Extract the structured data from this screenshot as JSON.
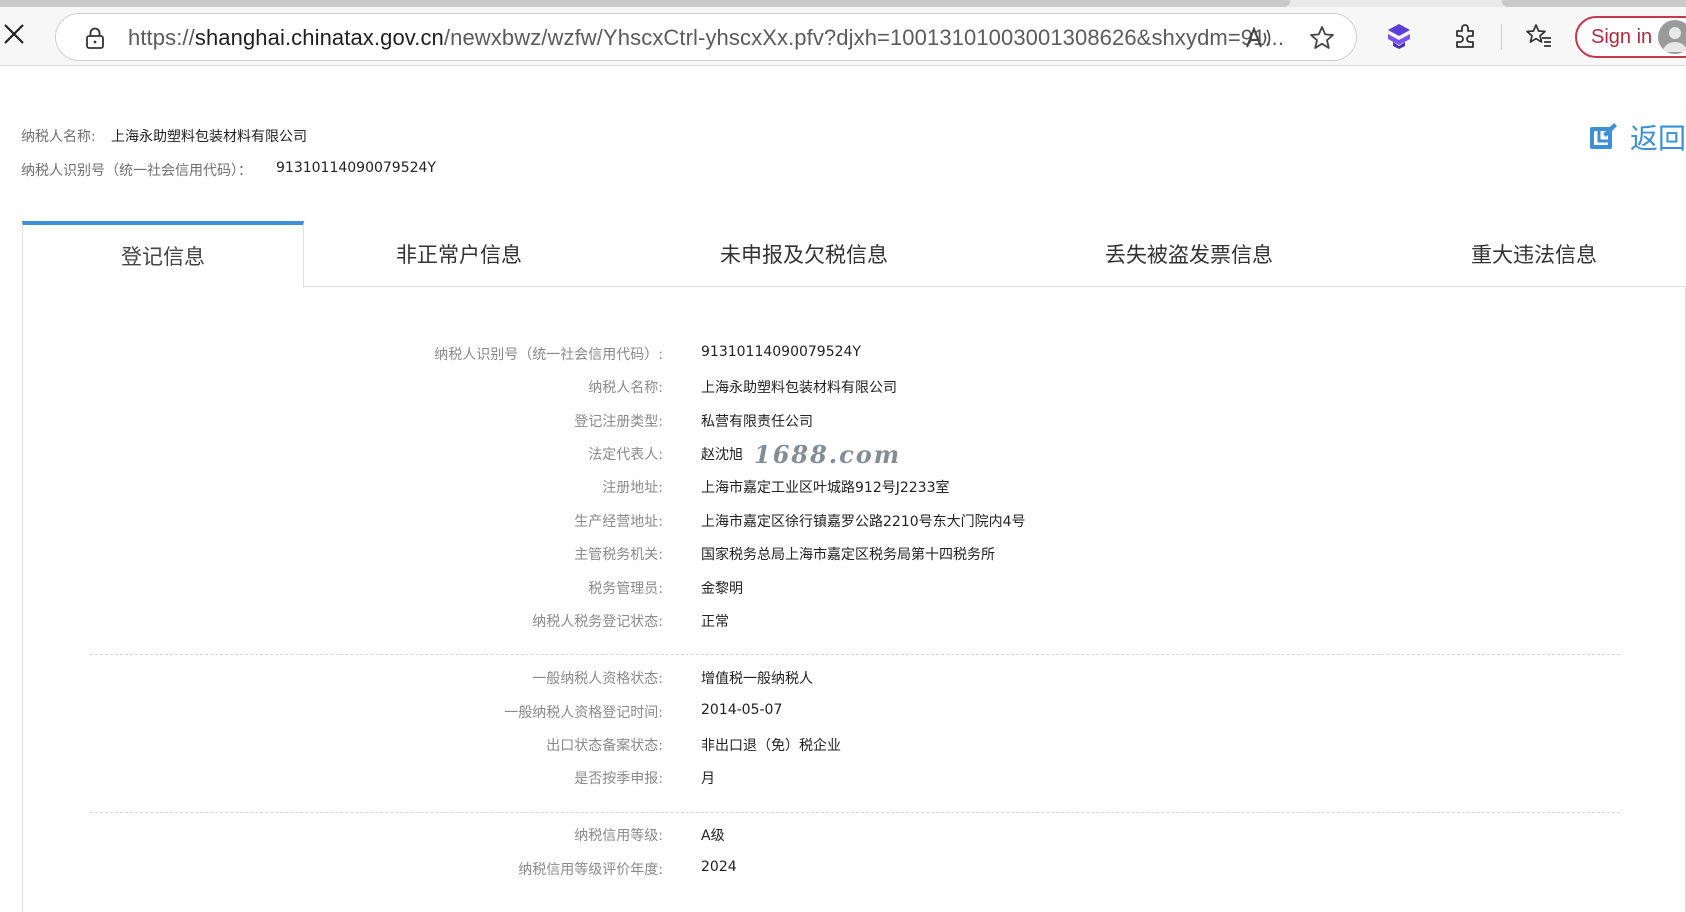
{
  "browser": {
    "url_prefix": "https://",
    "url_host": "shanghai.chinatax.gov.cn",
    "url_path": "/newxbwz/wzfw/YhscxCtrl-yhscxXx.pfv?djxh=10013101003001308626&shxydm=91...",
    "signin_label": "Sign in",
    "icons": [
      "close-icon",
      "lock-icon",
      "read-aloud-icon",
      "favorite-star-icon",
      "copilot-icon",
      "extensions-icon",
      "favorites-icon",
      "avatar"
    ]
  },
  "header": {
    "name_label": "纳税人名称:",
    "name_value": "上海永助塑料包装材料有限公司",
    "id_label": "纳税人识别号（统一社会信用代码）：",
    "id_value": "91310114090079524Y",
    "return_label": "返回"
  },
  "tabs": [
    {
      "label": "登记信息",
      "active": true
    },
    {
      "label": "非正常户信息",
      "active": false
    },
    {
      "label": "未申报及欠税信息",
      "active": false
    },
    {
      "label": "丢失被盗发票信息",
      "active": false
    },
    {
      "label": "重大违法信息",
      "active": false
    }
  ],
  "details": {
    "group1": [
      {
        "label": "纳税人识别号（统一社会信用代码）:",
        "value": "91310114090079524Y"
      },
      {
        "label": "纳税人名称:",
        "value": "上海永助塑料包装材料有限公司"
      },
      {
        "label": "登记注册类型:",
        "value": "私营有限责任公司"
      },
      {
        "label": "法定代表人:",
        "value": "赵沈旭"
      },
      {
        "label": "注册地址:",
        "value": "上海市嘉定工业区叶城路912号J2233室"
      },
      {
        "label": "生产经营地址:",
        "value": "上海市嘉定区徐行镇嘉罗公路2210号东大门院内4号"
      },
      {
        "label": "主管税务机关:",
        "value": "国家税务总局上海市嘉定区税务局第十四税务所"
      },
      {
        "label": "税务管理员:",
        "value": "金黎明"
      },
      {
        "label": "纳税人税务登记状态:",
        "value": "正常"
      }
    ],
    "group2": [
      {
        "label": "一般纳税人资格状态:",
        "value": "增值税一般纳税人"
      },
      {
        "label": "一般纳税人资格登记时间:",
        "value": "2014-05-07"
      },
      {
        "label": "出口状态备案状态:",
        "value": "非出口退（免）税企业"
      },
      {
        "label": "是否按季申报:",
        "value": "月"
      }
    ],
    "group3": [
      {
        "label": "纳税信用等级:",
        "value": "A级"
      },
      {
        "label": "纳税信用等级评价年度:",
        "value": "2024"
      }
    ]
  },
  "watermark": "1688.com",
  "colors": {
    "accent": "#3d8fd8",
    "signin_border": "#c4384b",
    "label_gray": "#8a8a8a"
  }
}
